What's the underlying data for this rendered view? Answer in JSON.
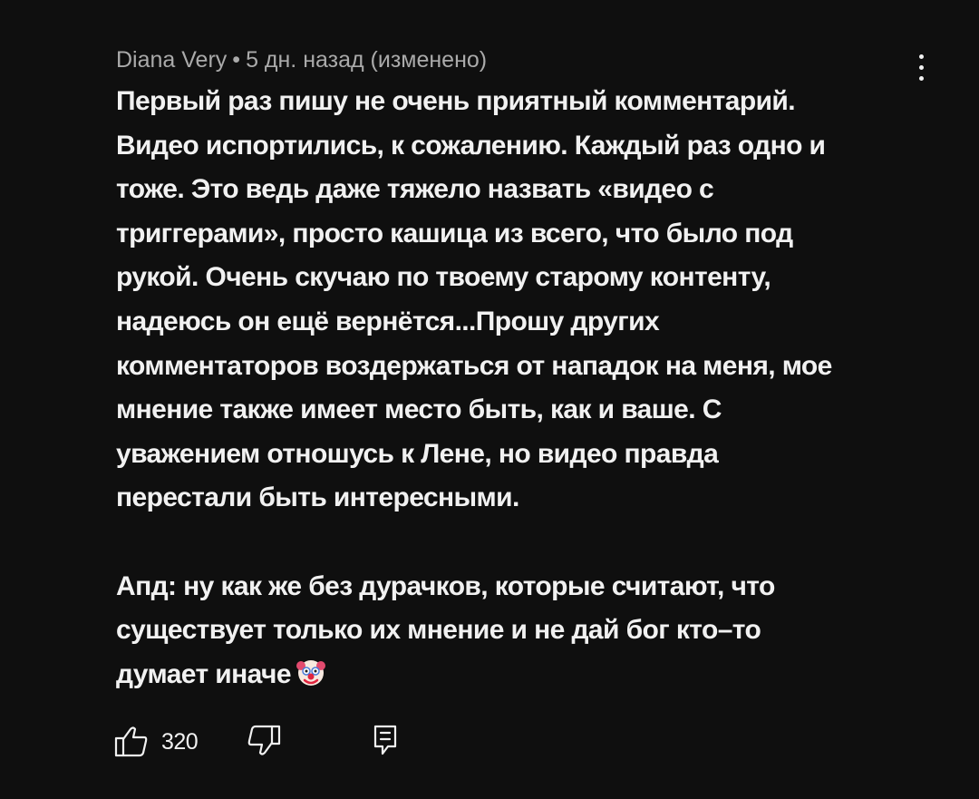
{
  "comment": {
    "author": "Diana Very",
    "separator": "•",
    "time": "5 дн. назад (изменено)",
    "paragraph1": "Первый раз пишу не очень приятный комментарий.\nВидео испортились, к сожалению. Каждый раз одно и\nтоже. Это ведь даже тяжело назвать «видео с\nтриггерами», просто кашица из всего, что было под\nрукой. Очень скучаю по твоему старому контенту,\nнадеюсь он ещё вернётся...Прошу других\nкомментаторов воздержаться от нападок на меня, мое\nмнение также имеет место быть, как и ваше. С\nуважением отношусь к Лене, но видео правда\nперестали быть интересными.",
    "paragraph2": "Апд: ну как же без дурачков, которые считают, что\nсуществует только их мнение и не дай бог кто–то\nдумает иначе",
    "emoji_icon": "clown-face-icon"
  },
  "actions": {
    "like_icon": "thumbs-up-icon",
    "like_count": "320",
    "dislike_icon": "thumbs-down-icon",
    "reply_icon": "reply-icon",
    "more_icon": "more-vertical-icon"
  },
  "colors": {
    "background": "#0f0f0f",
    "text": "#f1f1f1",
    "secondary_text": "#aaaaaa"
  }
}
